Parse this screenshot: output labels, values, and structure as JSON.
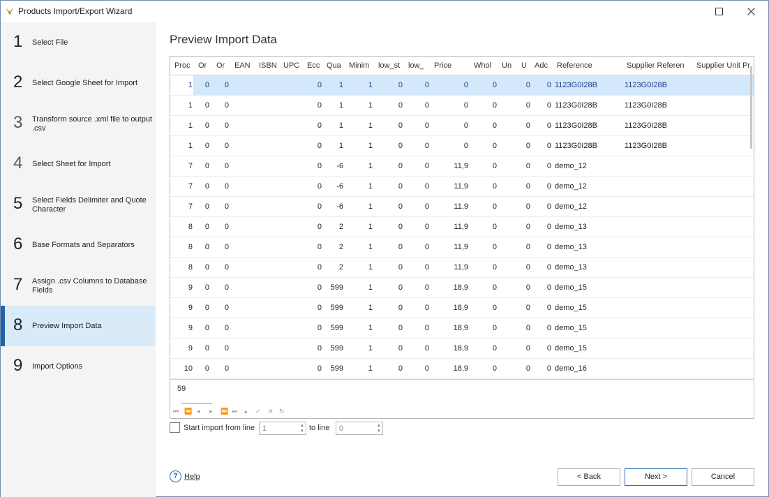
{
  "window": {
    "title": "Products Import/Export Wizard"
  },
  "steps": [
    {
      "num": "1",
      "label": "Select File"
    },
    {
      "num": "2",
      "label": "Select Google Sheet for Import"
    },
    {
      "num": "3",
      "label": "Transform source .xml file to output .csv"
    },
    {
      "num": "4",
      "label": "Select Sheet for Import"
    },
    {
      "num": "5",
      "label": "Select Fields Delimiter and Quote Character"
    },
    {
      "num": "6",
      "label": "Base Formats and Separators"
    },
    {
      "num": "7",
      "label": "Assign .csv Columns to Database Fields"
    },
    {
      "num": "8",
      "label": "Preview Import Data"
    },
    {
      "num": "9",
      "label": "Import Options"
    }
  ],
  "active_step": 8,
  "main": {
    "title": "Preview Import Data"
  },
  "grid": {
    "columns": [
      "Proc",
      "Or",
      "Or",
      "EAN",
      "ISBN",
      "UPC",
      "Ecc",
      "Qua",
      "Minim",
      "low_st",
      "low_",
      "Price",
      "Whol",
      "Un",
      "U",
      "Adc",
      "Reference",
      "Supplier Referen",
      "Supplier Unit Pr"
    ],
    "rows": [
      [
        "1",
        "0",
        "0",
        "",
        "",
        "",
        "0",
        "1",
        "1",
        "0",
        "0",
        "0",
        "0",
        "",
        "0",
        "0",
        "1123G0I28B",
        "1123G0I28B"
      ],
      [
        "1",
        "0",
        "0",
        "",
        "",
        "",
        "0",
        "1",
        "1",
        "0",
        "0",
        "0",
        "0",
        "",
        "0",
        "0",
        "1123G0I28B",
        "1123G0I28B"
      ],
      [
        "1",
        "0",
        "0",
        "",
        "",
        "",
        "0",
        "1",
        "1",
        "0",
        "0",
        "0",
        "0",
        "",
        "0",
        "0",
        "1123G0I28B",
        "1123G0I28B"
      ],
      [
        "1",
        "0",
        "0",
        "",
        "",
        "",
        "0",
        "1",
        "1",
        "0",
        "0",
        "0",
        "0",
        "",
        "0",
        "0",
        "1123G0I28B",
        "1123G0I28B"
      ],
      [
        "7",
        "0",
        "0",
        "",
        "",
        "",
        "0",
        "-6",
        "1",
        "0",
        "0",
        "11,9",
        "0",
        "",
        "0",
        "0",
        "demo_12",
        ""
      ],
      [
        "7",
        "0",
        "0",
        "",
        "",
        "",
        "0",
        "-6",
        "1",
        "0",
        "0",
        "11,9",
        "0",
        "",
        "0",
        "0",
        "demo_12",
        ""
      ],
      [
        "7",
        "0",
        "0",
        "",
        "",
        "",
        "0",
        "-6",
        "1",
        "0",
        "0",
        "11,9",
        "0",
        "",
        "0",
        "0",
        "demo_12",
        ""
      ],
      [
        "8",
        "0",
        "0",
        "",
        "",
        "",
        "0",
        "2",
        "1",
        "0",
        "0",
        "11,9",
        "0",
        "",
        "0",
        "0",
        "demo_13",
        ""
      ],
      [
        "8",
        "0",
        "0",
        "",
        "",
        "",
        "0",
        "2",
        "1",
        "0",
        "0",
        "11,9",
        "0",
        "",
        "0",
        "0",
        "demo_13",
        ""
      ],
      [
        "8",
        "0",
        "0",
        "",
        "",
        "",
        "0",
        "2",
        "1",
        "0",
        "0",
        "11,9",
        "0",
        "",
        "0",
        "0",
        "demo_13",
        ""
      ],
      [
        "9",
        "0",
        "0",
        "",
        "",
        "",
        "0",
        "599",
        "1",
        "0",
        "0",
        "18,9",
        "0",
        "",
        "0",
        "0",
        "demo_15",
        ""
      ],
      [
        "9",
        "0",
        "0",
        "",
        "",
        "",
        "0",
        "599",
        "1",
        "0",
        "0",
        "18,9",
        "0",
        "",
        "0",
        "0",
        "demo_15",
        ""
      ],
      [
        "9",
        "0",
        "0",
        "",
        "",
        "",
        "0",
        "599",
        "1",
        "0",
        "0",
        "18,9",
        "0",
        "",
        "0",
        "0",
        "demo_15",
        ""
      ],
      [
        "9",
        "0",
        "0",
        "",
        "",
        "",
        "0",
        "599",
        "1",
        "0",
        "0",
        "18,9",
        "0",
        "",
        "0",
        "0",
        "demo_15",
        ""
      ],
      [
        "10",
        "0",
        "0",
        "",
        "",
        "",
        "0",
        "599",
        "1",
        "0",
        "0",
        "18,9",
        "0",
        "",
        "0",
        "0",
        "demo_16",
        ""
      ]
    ],
    "selected_row": 0,
    "record_count": "59"
  },
  "options": {
    "start_import_label": "Start import from line",
    "start_line_value": "1",
    "to_line_label": "to line",
    "to_line_value": "0"
  },
  "buttons": {
    "help": "Help",
    "back": "< Back",
    "next": "Next >",
    "cancel": "Cancel"
  },
  "colors": {
    "active_step_bg": "#d9ebf9",
    "active_step_bar": "#2463a8",
    "selected_row_bg": "#d3e8fb",
    "selected_row_text": "#1a3e8c",
    "help_icon": "#1f6bc2"
  }
}
